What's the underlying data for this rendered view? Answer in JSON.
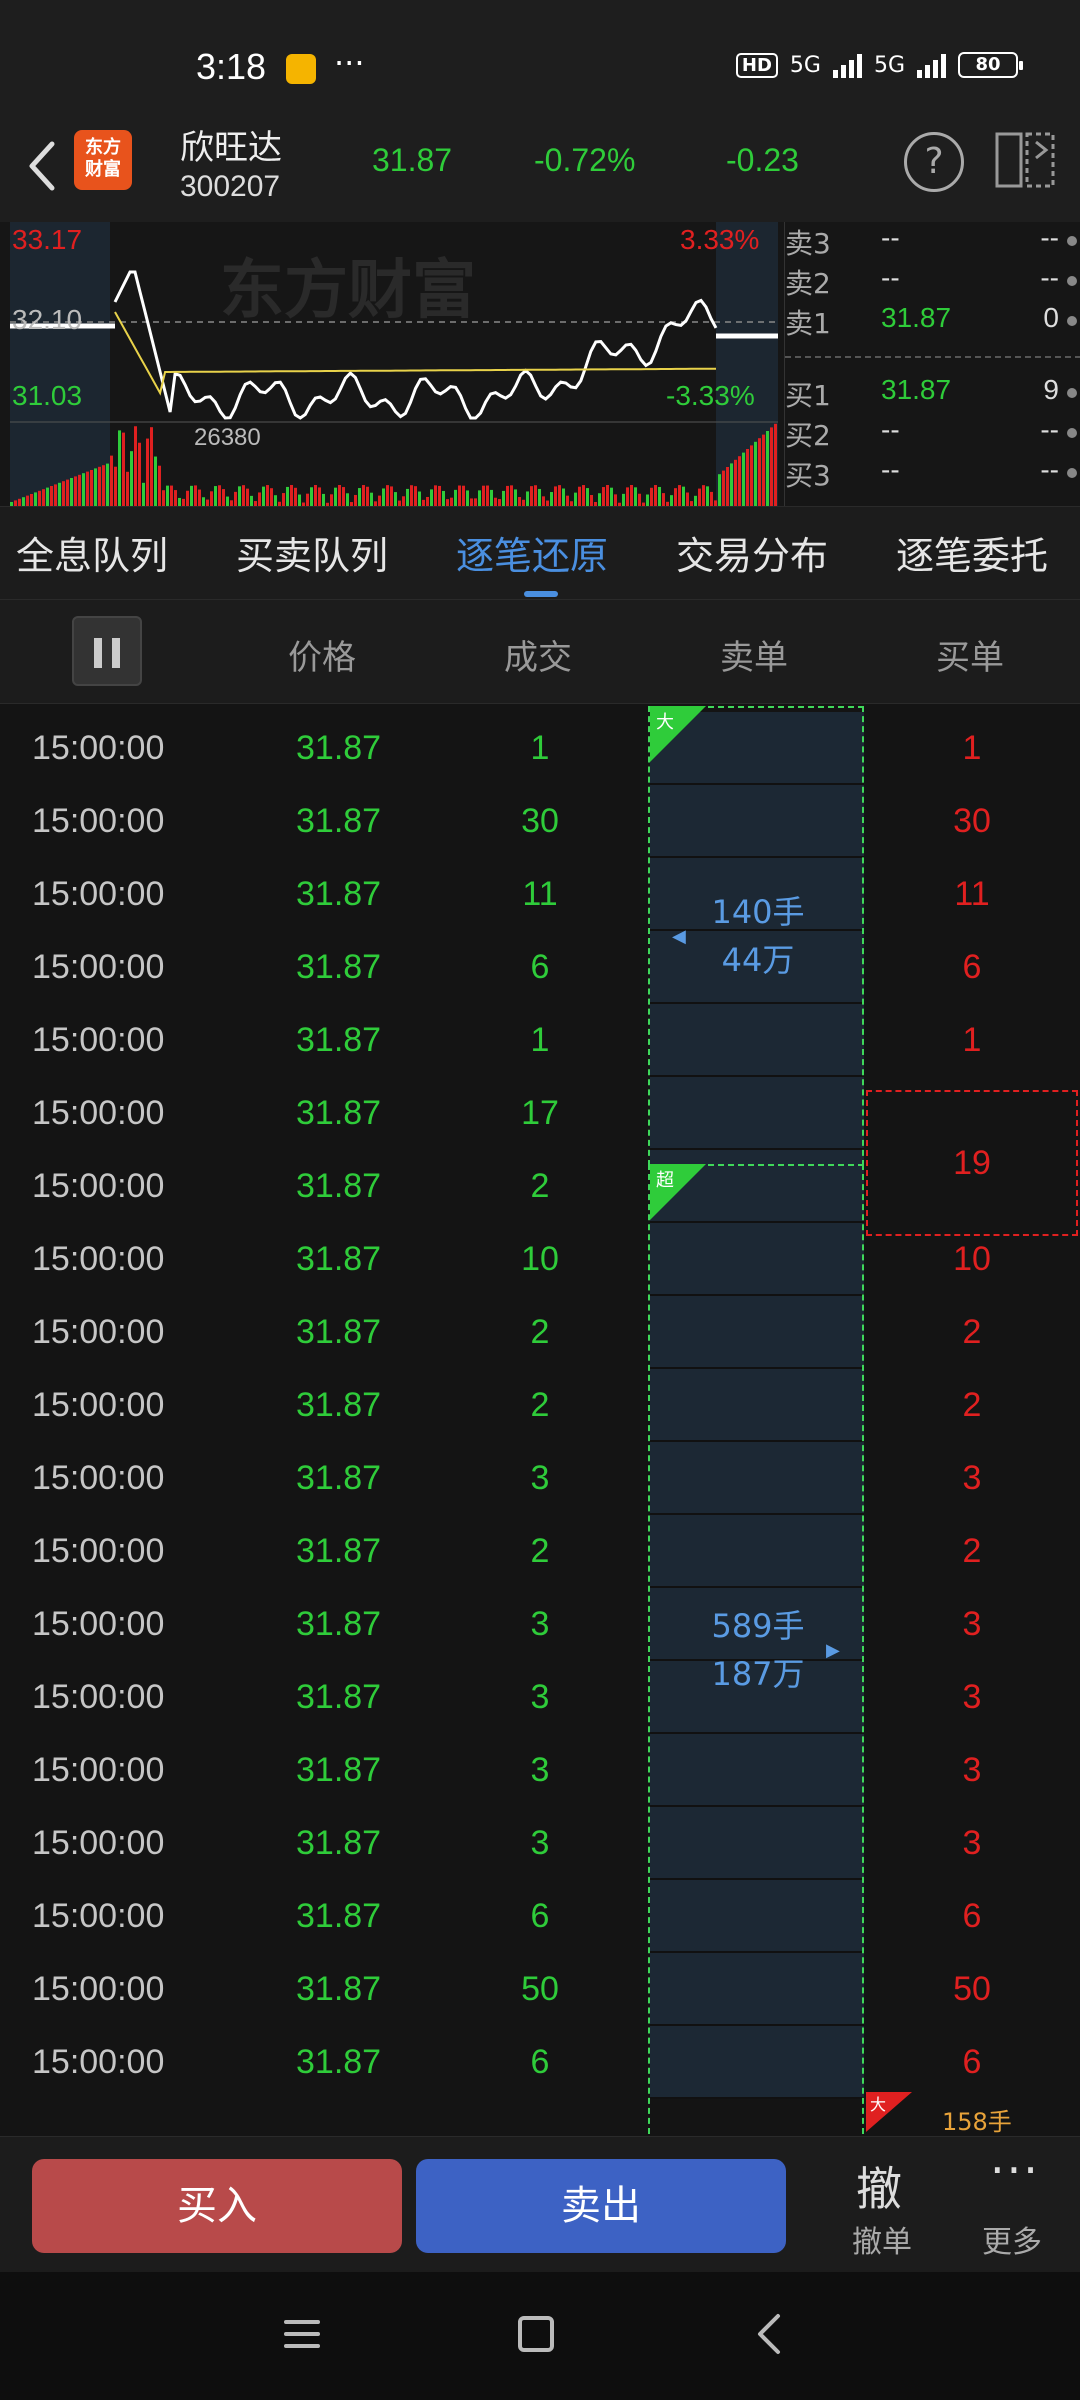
{
  "status_bar": {
    "time": "3:18",
    "dots": "···",
    "hd_label": "HD",
    "net1": "5G",
    "net2": "5G",
    "battery": "80"
  },
  "header": {
    "logo_text_line1": "东方",
    "logo_text_line2": "财富",
    "stock_name": "欣旺达",
    "stock_code": "300207",
    "last_price": "31.87",
    "change_pct": "-0.72%",
    "change_amt": "-0.23",
    "help_glyph": "?"
  },
  "chart": {
    "watermark": "东方财富",
    "high_price": "33.17",
    "high_pct": "3.33%",
    "ref_price": "32.10",
    "low_price": "31.03",
    "low_pct": "-3.33%",
    "volume_peak_label": "26380",
    "colors": {
      "up": "#e02020",
      "down": "#2fcc3a",
      "price_line": "#ffffff",
      "avg_line": "#e8d24a"
    }
  },
  "order_book": {
    "asks": [
      {
        "label": "卖3",
        "price": "--",
        "volume": "--"
      },
      {
        "label": "卖2",
        "price": "--",
        "volume": "--"
      },
      {
        "label": "卖1",
        "price": "31.87",
        "volume": "0"
      }
    ],
    "bids": [
      {
        "label": "买1",
        "price": "31.87",
        "volume": "9"
      },
      {
        "label": "买2",
        "price": "--",
        "volume": "--"
      },
      {
        "label": "买3",
        "price": "--",
        "volume": "--"
      }
    ]
  },
  "tabs": [
    {
      "label": "全息队列",
      "active": false
    },
    {
      "label": "买卖队列",
      "active": false
    },
    {
      "label": "逐笔还原",
      "active": true
    },
    {
      "label": "交易分布",
      "active": false
    },
    {
      "label": "逐笔委托",
      "active": false
    }
  ],
  "columns": {
    "price": "价格",
    "volume": "成交",
    "sell": "卖单",
    "buy": "买单"
  },
  "trades": [
    {
      "time": "15:00:00",
      "price": "31.87",
      "volume": "1",
      "buy": "1"
    },
    {
      "time": "15:00:00",
      "price": "31.87",
      "volume": "30",
      "buy": "30"
    },
    {
      "time": "15:00:00",
      "price": "31.87",
      "volume": "11",
      "buy": "11"
    },
    {
      "time": "15:00:00",
      "price": "31.87",
      "volume": "6",
      "buy": "6"
    },
    {
      "time": "15:00:00",
      "price": "31.87",
      "volume": "1",
      "buy": "1"
    },
    {
      "time": "15:00:00",
      "price": "31.87",
      "volume": "17",
      "buy": ""
    },
    {
      "time": "15:00:00",
      "price": "31.87",
      "volume": "2",
      "buy": ""
    },
    {
      "time": "15:00:00",
      "price": "31.87",
      "volume": "10",
      "buy": "10"
    },
    {
      "time": "15:00:00",
      "price": "31.87",
      "volume": "2",
      "buy": "2"
    },
    {
      "time": "15:00:00",
      "price": "31.87",
      "volume": "2",
      "buy": "2"
    },
    {
      "time": "15:00:00",
      "price": "31.87",
      "volume": "3",
      "buy": "3"
    },
    {
      "time": "15:00:00",
      "price": "31.87",
      "volume": "2",
      "buy": "2"
    },
    {
      "time": "15:00:00",
      "price": "31.87",
      "volume": "3",
      "buy": "3"
    },
    {
      "time": "15:00:00",
      "price": "31.87",
      "volume": "3",
      "buy": "3"
    },
    {
      "time": "15:00:00",
      "price": "31.87",
      "volume": "3",
      "buy": "3"
    },
    {
      "time": "15:00:00",
      "price": "31.87",
      "volume": "3",
      "buy": "3"
    },
    {
      "time": "15:00:00",
      "price": "31.87",
      "volume": "6",
      "buy": "6"
    },
    {
      "time": "15:00:00",
      "price": "31.87",
      "volume": "50",
      "buy": "50"
    },
    {
      "time": "15:00:00",
      "price": "31.87",
      "volume": "6",
      "buy": "6"
    }
  ],
  "sell_groups": [
    {
      "tag": "大",
      "line1": "140手",
      "line2": "44万"
    },
    {
      "tag": "超",
      "line1": "589手",
      "line2": "187万"
    }
  ],
  "buy_group": {
    "value": "19"
  },
  "partial_row": {
    "tag": "大",
    "text": "158手"
  },
  "bottom_bar": {
    "buy_label": "买入",
    "sell_label": "卖出",
    "cancel_glyph": "撤",
    "cancel_label": "撤单",
    "more_glyph": "···",
    "more_label": "更多"
  }
}
